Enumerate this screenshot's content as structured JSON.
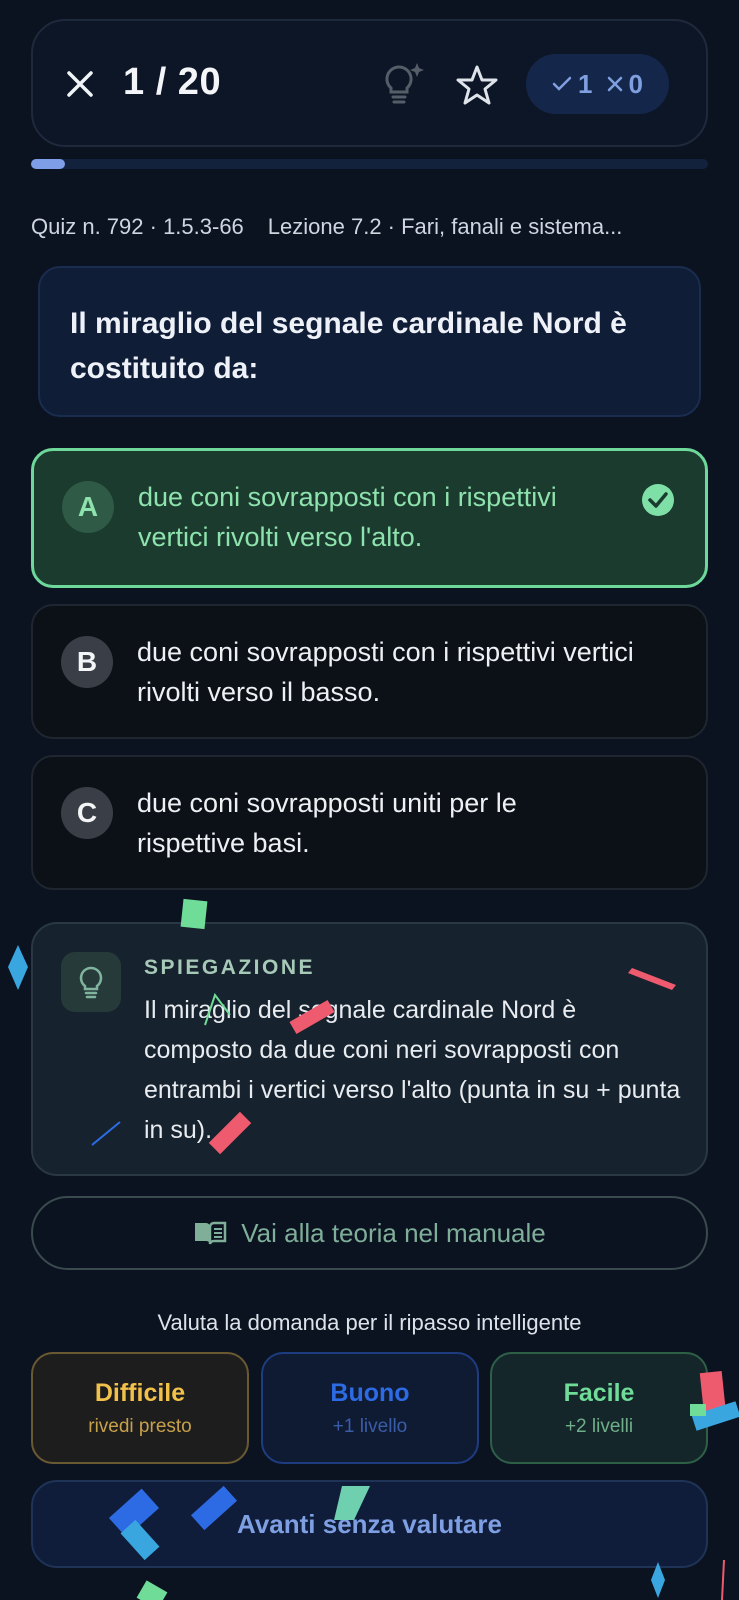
{
  "header": {
    "counter": "1 / 20",
    "correct_count": "1",
    "wrong_count": "0"
  },
  "progress": {
    "fraction": 0.05
  },
  "meta": {
    "quiz": "Quiz n. 792 · 1.5.3-66",
    "lesson": "Lezione 7.2 · Fari, fanali e sistema..."
  },
  "question": {
    "text": "Il miraglio del segnale cardinale Nord è costituito da:"
  },
  "answers": [
    {
      "letter": "A",
      "text": "due coni sovrapposti con i rispettivi vertici rivolti verso l'alto.",
      "state": "correct"
    },
    {
      "letter": "B",
      "text": "due coni sovrapposti con i rispettivi vertici rivolti verso il basso.",
      "state": "neutral"
    },
    {
      "letter": "C",
      "text": "due coni sovrapposti uniti per le rispettive basi.",
      "state": "neutral"
    }
  ],
  "explanation": {
    "title": "SPIEGAZIONE",
    "text": "Il miraglio del segnale cardinale Nord è composto da due coni neri sovrapposti con entrambi i vertici verso l'alto (punta in su + punta in su)."
  },
  "theory_button": {
    "label": "Vai alla teoria nel manuale",
    "icon": "book-icon"
  },
  "rating": {
    "label": "Valuta la domanda per il ripasso intelligente",
    "options": [
      {
        "title": "Difficile",
        "subtitle": "rivedi presto"
      },
      {
        "title": "Buono",
        "subtitle": "+1 livello"
      },
      {
        "title": "Facile",
        "subtitle": "+2 livelli"
      }
    ]
  },
  "next_button": {
    "label": "Avanti senza valutare"
  },
  "colors": {
    "background": "#0b1220",
    "correct": "#6ed79a",
    "accent": "#7f9ee8",
    "hard": "#f2c14a",
    "good": "#2d6be5",
    "easy": "#6fdc98"
  }
}
